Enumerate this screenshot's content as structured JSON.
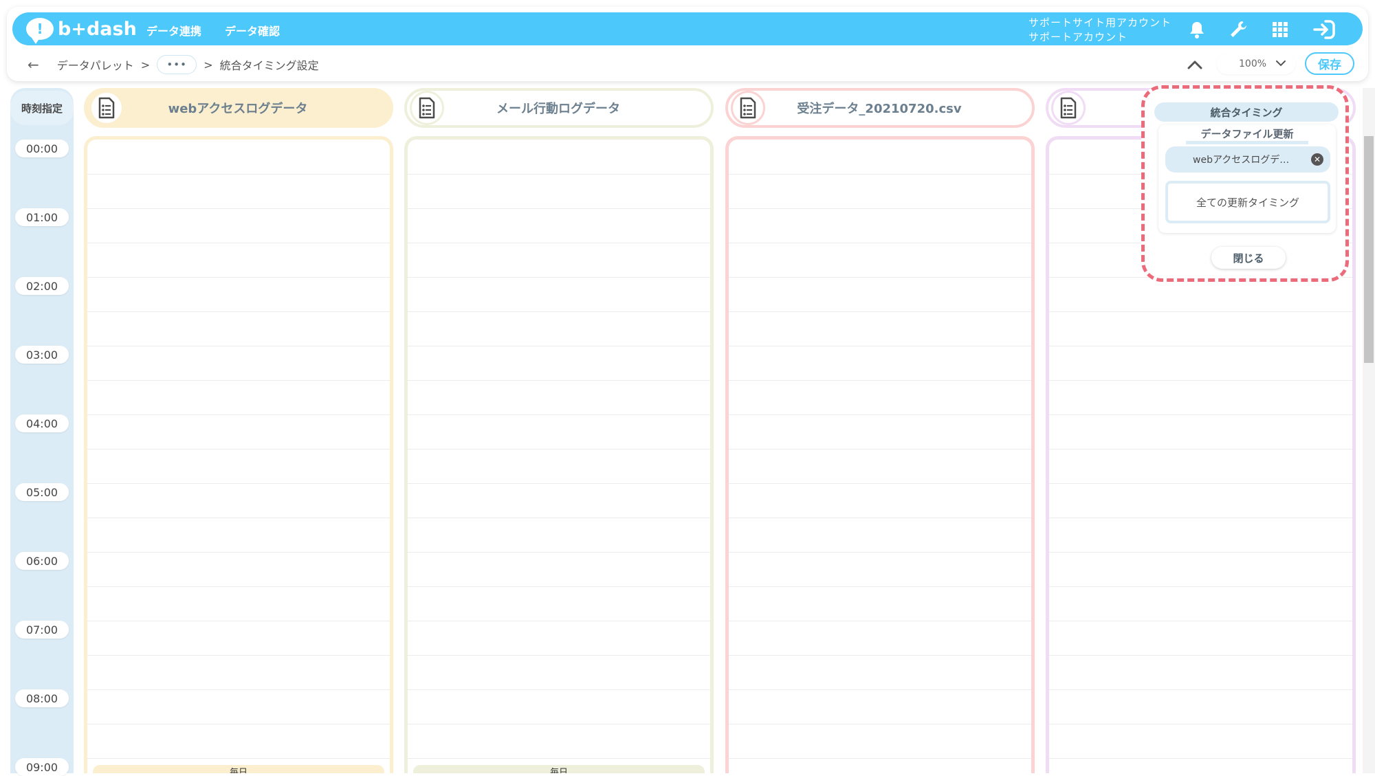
{
  "app": {
    "logo_text": "b+dash",
    "nav": [
      "データ連携",
      "データ確認"
    ],
    "account_line1": "サポートサイト用アカウント",
    "account_line2": "サポートアカウント"
  },
  "breadcrumb": {
    "back": "←",
    "item1": "データパレット",
    "sep": ">",
    "dots": "•••",
    "current": "統合タイミング設定"
  },
  "controls": {
    "zoom": "100%",
    "save_label": "保存"
  },
  "time_header": "時刻指定",
  "times": [
    "00:00",
    "01:00",
    "02:00",
    "03:00",
    "04:00",
    "05:00",
    "06:00",
    "07:00",
    "08:00",
    "09:00"
  ],
  "columns": [
    {
      "title": "webアクセスログデータ",
      "color": "#fbefcf",
      "border": "#fbefcf",
      "foot": "毎日"
    },
    {
      "title": "メール行動ログデータ",
      "color": "#ffffff",
      "border": "#eef0dc",
      "foot": "毎日"
    },
    {
      "title": "受注データ_20210720.csv",
      "color": "#ffffff",
      "border": "#fbd3d3",
      "foot": ""
    },
    {
      "title": "",
      "color": "#ffffff",
      "border": "#f1dcf5",
      "foot": ""
    }
  ],
  "popup": {
    "title": "統合タイミング",
    "subtitle": "データファイル更新",
    "chip": "webアクセスログデ…",
    "all_timing": "全ての更新タイミング",
    "close": "閉じる"
  },
  "colors": {
    "brand": "#4cc8fb",
    "highlight": "#ec6b7a"
  }
}
